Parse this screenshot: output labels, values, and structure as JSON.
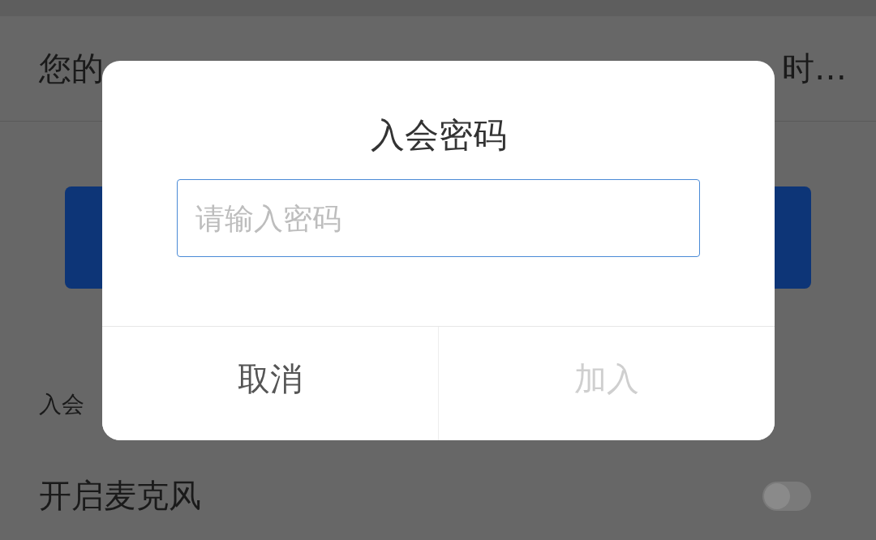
{
  "background": {
    "name_row": {
      "left_text": "您的",
      "right_text": "时…"
    },
    "section_label": "入会",
    "mic_row": {
      "label": "开启麦克风",
      "on": false
    }
  },
  "dialog": {
    "title": "入会密码",
    "password_field": {
      "placeholder": "请输入密码"
    },
    "buttons": [
      {
        "label": "取消",
        "disabled": false
      },
      {
        "label": "加入",
        "disabled": true
      }
    ]
  }
}
